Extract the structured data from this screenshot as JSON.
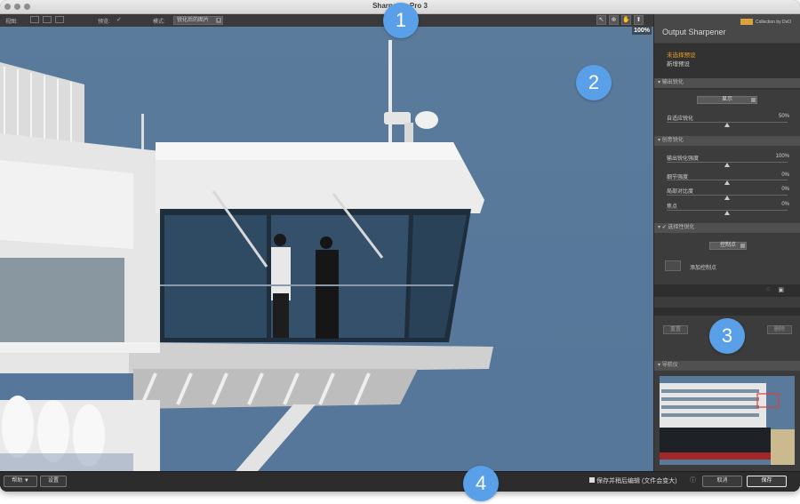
{
  "window": {
    "title": "Sharpener Pro 3"
  },
  "toolbar": {
    "view_label": "视图:",
    "preview_label": "预览:",
    "preview_check": "✓",
    "mode_label": "模式:",
    "mode_value": "锐化后的图片",
    "zoom_tools": [
      "zoom-fit-icon",
      "zoom-in-icon",
      "hand-icon",
      "picker-icon"
    ],
    "zoom_level": "100%"
  },
  "panel": {
    "brand": "Collection by DxO",
    "title": "Output Sharpener",
    "preset_unselected": "未选择预设",
    "preset_new": "新增预设",
    "output_section": "输出锐化",
    "output_display": "显示",
    "adaptive_label": "自适应锐化",
    "adaptive_value": "50%",
    "creative_section": "创意锐化",
    "creative_rows": [
      {
        "label": "输出锐化强度",
        "value": "100%",
        "level": 1.0
      },
      {
        "label": "细节强度",
        "value": "0%",
        "level": 0.5
      },
      {
        "label": "局部对比度",
        "value": "0%",
        "level": 0.5
      },
      {
        "label": "焦点",
        "value": "0%",
        "level": 0.5
      }
    ],
    "selective_section": "选择性锐化",
    "selective_check": "✓",
    "control_point_select": "控制点",
    "add_control_point": "添加控制点",
    "reset_button": "重置",
    "delete_button": "删除",
    "navigator_section": "导航仪"
  },
  "bottombar": {
    "help_button": "帮助 ▼",
    "settings_button": "设置",
    "save_edit_label": "保存并稍后编辑 (文件会变大)",
    "cancel_button": "取消",
    "save_button": "保存"
  },
  "callouts": [
    "1",
    "2",
    "3",
    "4"
  ],
  "colors": {
    "sky": "#5a7a9b",
    "accent_preset": "#e8a020",
    "badge": "#5aa0e8"
  }
}
